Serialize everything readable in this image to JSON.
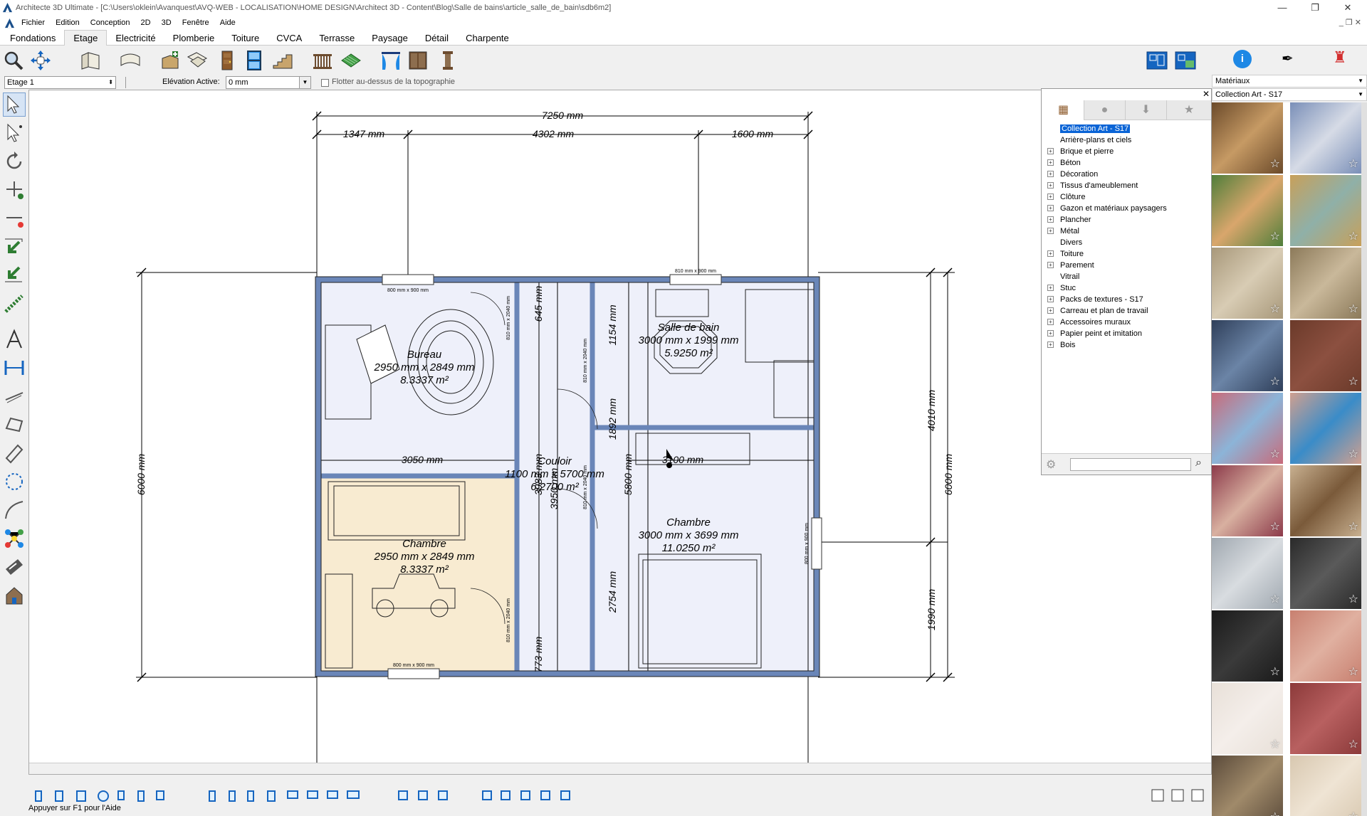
{
  "window": {
    "title": "Architecte 3D Ultimate - [C:\\Users\\oklein\\Avanquest\\AVQ-WEB - LOCALISATION\\HOME DESIGN\\Architect 3D - Content\\Blog\\Salle de bains\\article_salle_de_bain\\sdb6m2]"
  },
  "menu": [
    "Fichier",
    "Edition",
    "Conception",
    "2D",
    "3D",
    "Fenêtre",
    "Aide"
  ],
  "tabs": [
    "Fondations",
    "Etage",
    "Electricité",
    "Plomberie",
    "Toiture",
    "CVCA",
    "Terrasse",
    "Paysage",
    "Détail",
    "Charpente"
  ],
  "options": {
    "floor": "Etage 1",
    "elevation_label": "Elévation Active:",
    "elevation_value": "0 mm",
    "float_label": "Flotter au-dessus de la topographie"
  },
  "status": "Appuyer sur F1 pour l'Aide",
  "library": {
    "items": [
      "Collection Art - S17",
      "Arrière-plans et ciels",
      "Brique et pierre",
      "Béton",
      "Décoration",
      "Tissus d'ameublement",
      "Clôture",
      "Gazon et matériaux paysagers",
      "Plancher",
      "Métal",
      "Divers",
      "Toiture",
      "Parement",
      "Vitrail",
      "Stuc",
      "Packs de textures - S17",
      "Carreau et plan de travail",
      "Accessoires muraux",
      "Papier peint et imitation",
      "Bois"
    ],
    "expandable": [
      false,
      false,
      true,
      true,
      true,
      true,
      true,
      true,
      true,
      true,
      false,
      true,
      true,
      false,
      true,
      true,
      true,
      true,
      true,
      true
    ],
    "search_placeholder": ""
  },
  "materials": {
    "category": "Matériaux",
    "collection": "Collection Art - S17"
  },
  "plan": {
    "dims": {
      "top_total": "7250 mm",
      "top_a": "1347 mm",
      "top_b": "4302 mm",
      "top_c": "1600 mm",
      "left_total": "6000 mm",
      "right_total": "6000 mm",
      "right_a": "4010 mm",
      "right_b": "1990 mm",
      "bureau_w": "3050 mm",
      "sdb_w": "3100 mm",
      "c1": "645 mm",
      "c2": "1154 mm",
      "c3": "1892 mm",
      "c4": "5800 mm",
      "c5": "2754 mm",
      "c6": "773 mm",
      "c7": "3983 mm",
      "c8": "3950 mm"
    },
    "window_labels": {
      "w1": "800 mm x 900 mm",
      "w2": "810 mm x 900 mm",
      "w3": "800 mm x 900 mm",
      "w4": "800 mm x 900 mm"
    },
    "door_labels": {
      "d1": "810 mm x 2040 mm",
      "d2": "810 mm x 2040 mm",
      "d3": "810 mm x 2040 mm",
      "d4": "810 mm x 2040 mm"
    },
    "rooms": [
      {
        "name": "Bureau",
        "size": "2950 mm x 2849 mm",
        "area": "8.3337 m²"
      },
      {
        "name": "Salle de bain",
        "size": "3000 mm x 1999 mm",
        "area": "5.9250 m²"
      },
      {
        "name": "Couloir",
        "size": "1100 mm x 5700 mm",
        "area": "6.2700 m²"
      },
      {
        "name": "Chambre",
        "size": "3000 mm x 3699 mm",
        "area": "11.0250 m²"
      },
      {
        "name": "Chambre",
        "size": "2950 mm x 2849 mm",
        "area": "8.3337 m²"
      }
    ]
  }
}
